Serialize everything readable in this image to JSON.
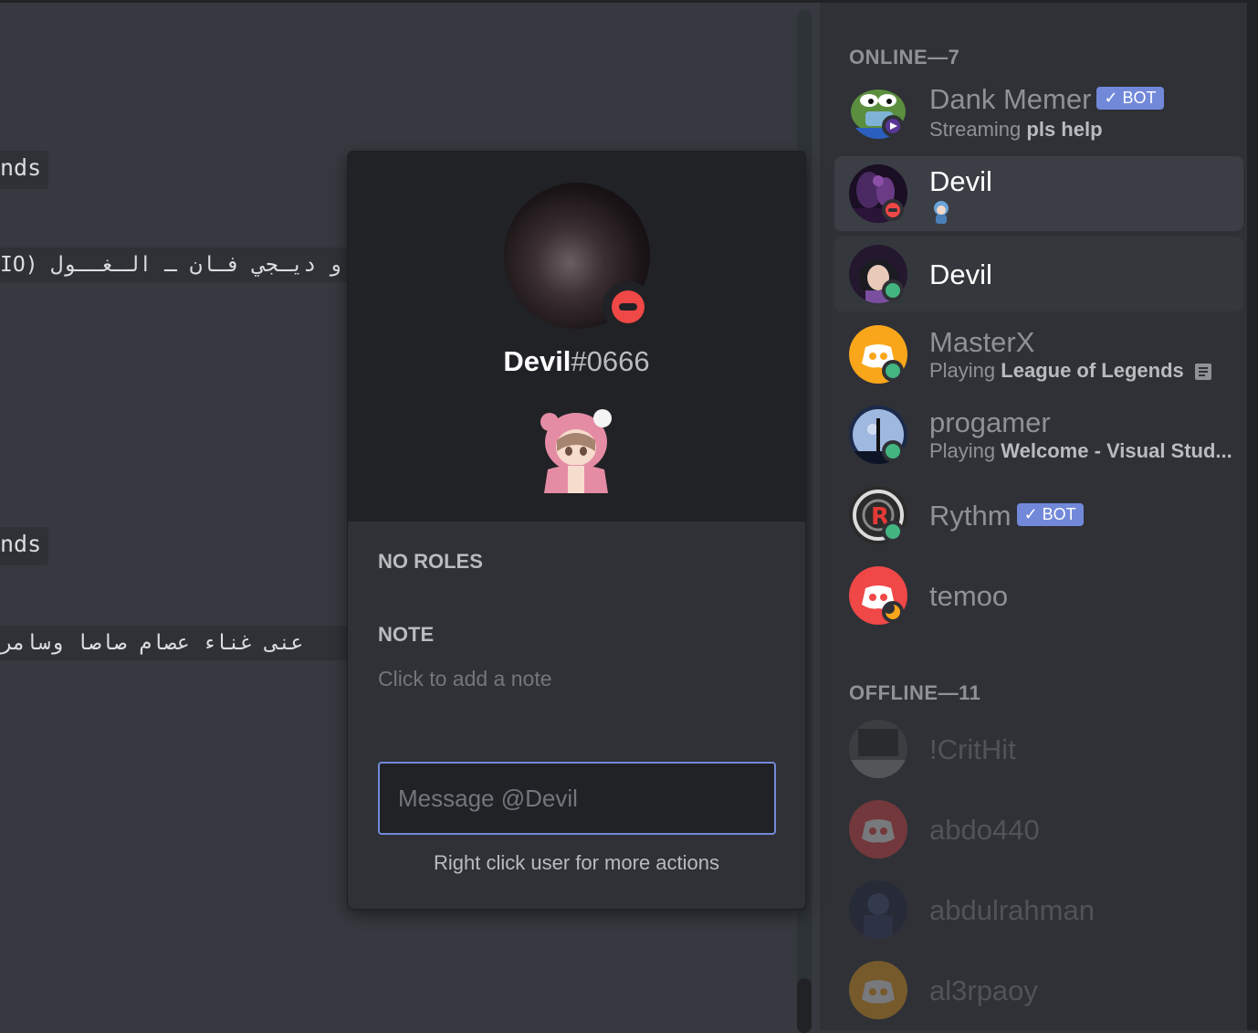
{
  "chat": {
    "chip1": "nds",
    "code1": "و ديـجي فـان ـ الـغــول  (IO",
    "chip2": "nds",
    "code2": "عنى غناء عصام صاصا وسامر"
  },
  "popout": {
    "username": "Devil",
    "discriminator": "#0666",
    "roles_label": "NO ROLES",
    "note_label": "NOTE",
    "note_placeholder": "Click to add a note",
    "message_placeholder": "Message @Devil",
    "hint": "Right click user for more actions"
  },
  "members": {
    "online_header": "ONLINE—7",
    "offline_header": "OFFLINE—11",
    "online": [
      {
        "name": "Dank Memer",
        "bot": "✓ BOT",
        "activity_prefix": "Streaming ",
        "activity_bold": "pls help",
        "status": "streaming",
        "avatar": "pepe-avatar"
      },
      {
        "name": "Devil",
        "status": "dnd",
        "avatar": "devil-avatar-1"
      },
      {
        "name": "Devil",
        "status": "online",
        "avatar": "devil-avatar-2"
      },
      {
        "name": "MasterX",
        "activity_prefix": "Playing ",
        "activity_bold": "League of Legends",
        "status": "online",
        "avatar": "discord-avatar-orange"
      },
      {
        "name": "progamer",
        "activity_prefix": "Playing ",
        "activity_bold": "Welcome - Visual Stud...",
        "status": "online",
        "avatar": "moon-avatar"
      },
      {
        "name": "Rythm",
        "bot": "✓ BOT",
        "status": "online",
        "avatar": "rythm-avatar"
      },
      {
        "name": "temoo",
        "status": "idle",
        "avatar": "discord-avatar-red"
      }
    ],
    "offline": [
      {
        "name": "!CritHit",
        "avatar": "crithit-avatar"
      },
      {
        "name": "abdo440",
        "avatar": "discord-avatar-red"
      },
      {
        "name": "abdulrahman",
        "avatar": "abdulrahman-avatar"
      },
      {
        "name": "al3rpaoy",
        "avatar": "discord-avatar-orange"
      }
    ]
  },
  "colors": {
    "online": "#43b581",
    "idle": "#faa61a",
    "dnd": "#f04747",
    "streaming": "#593695",
    "blurple": "#7289da"
  }
}
